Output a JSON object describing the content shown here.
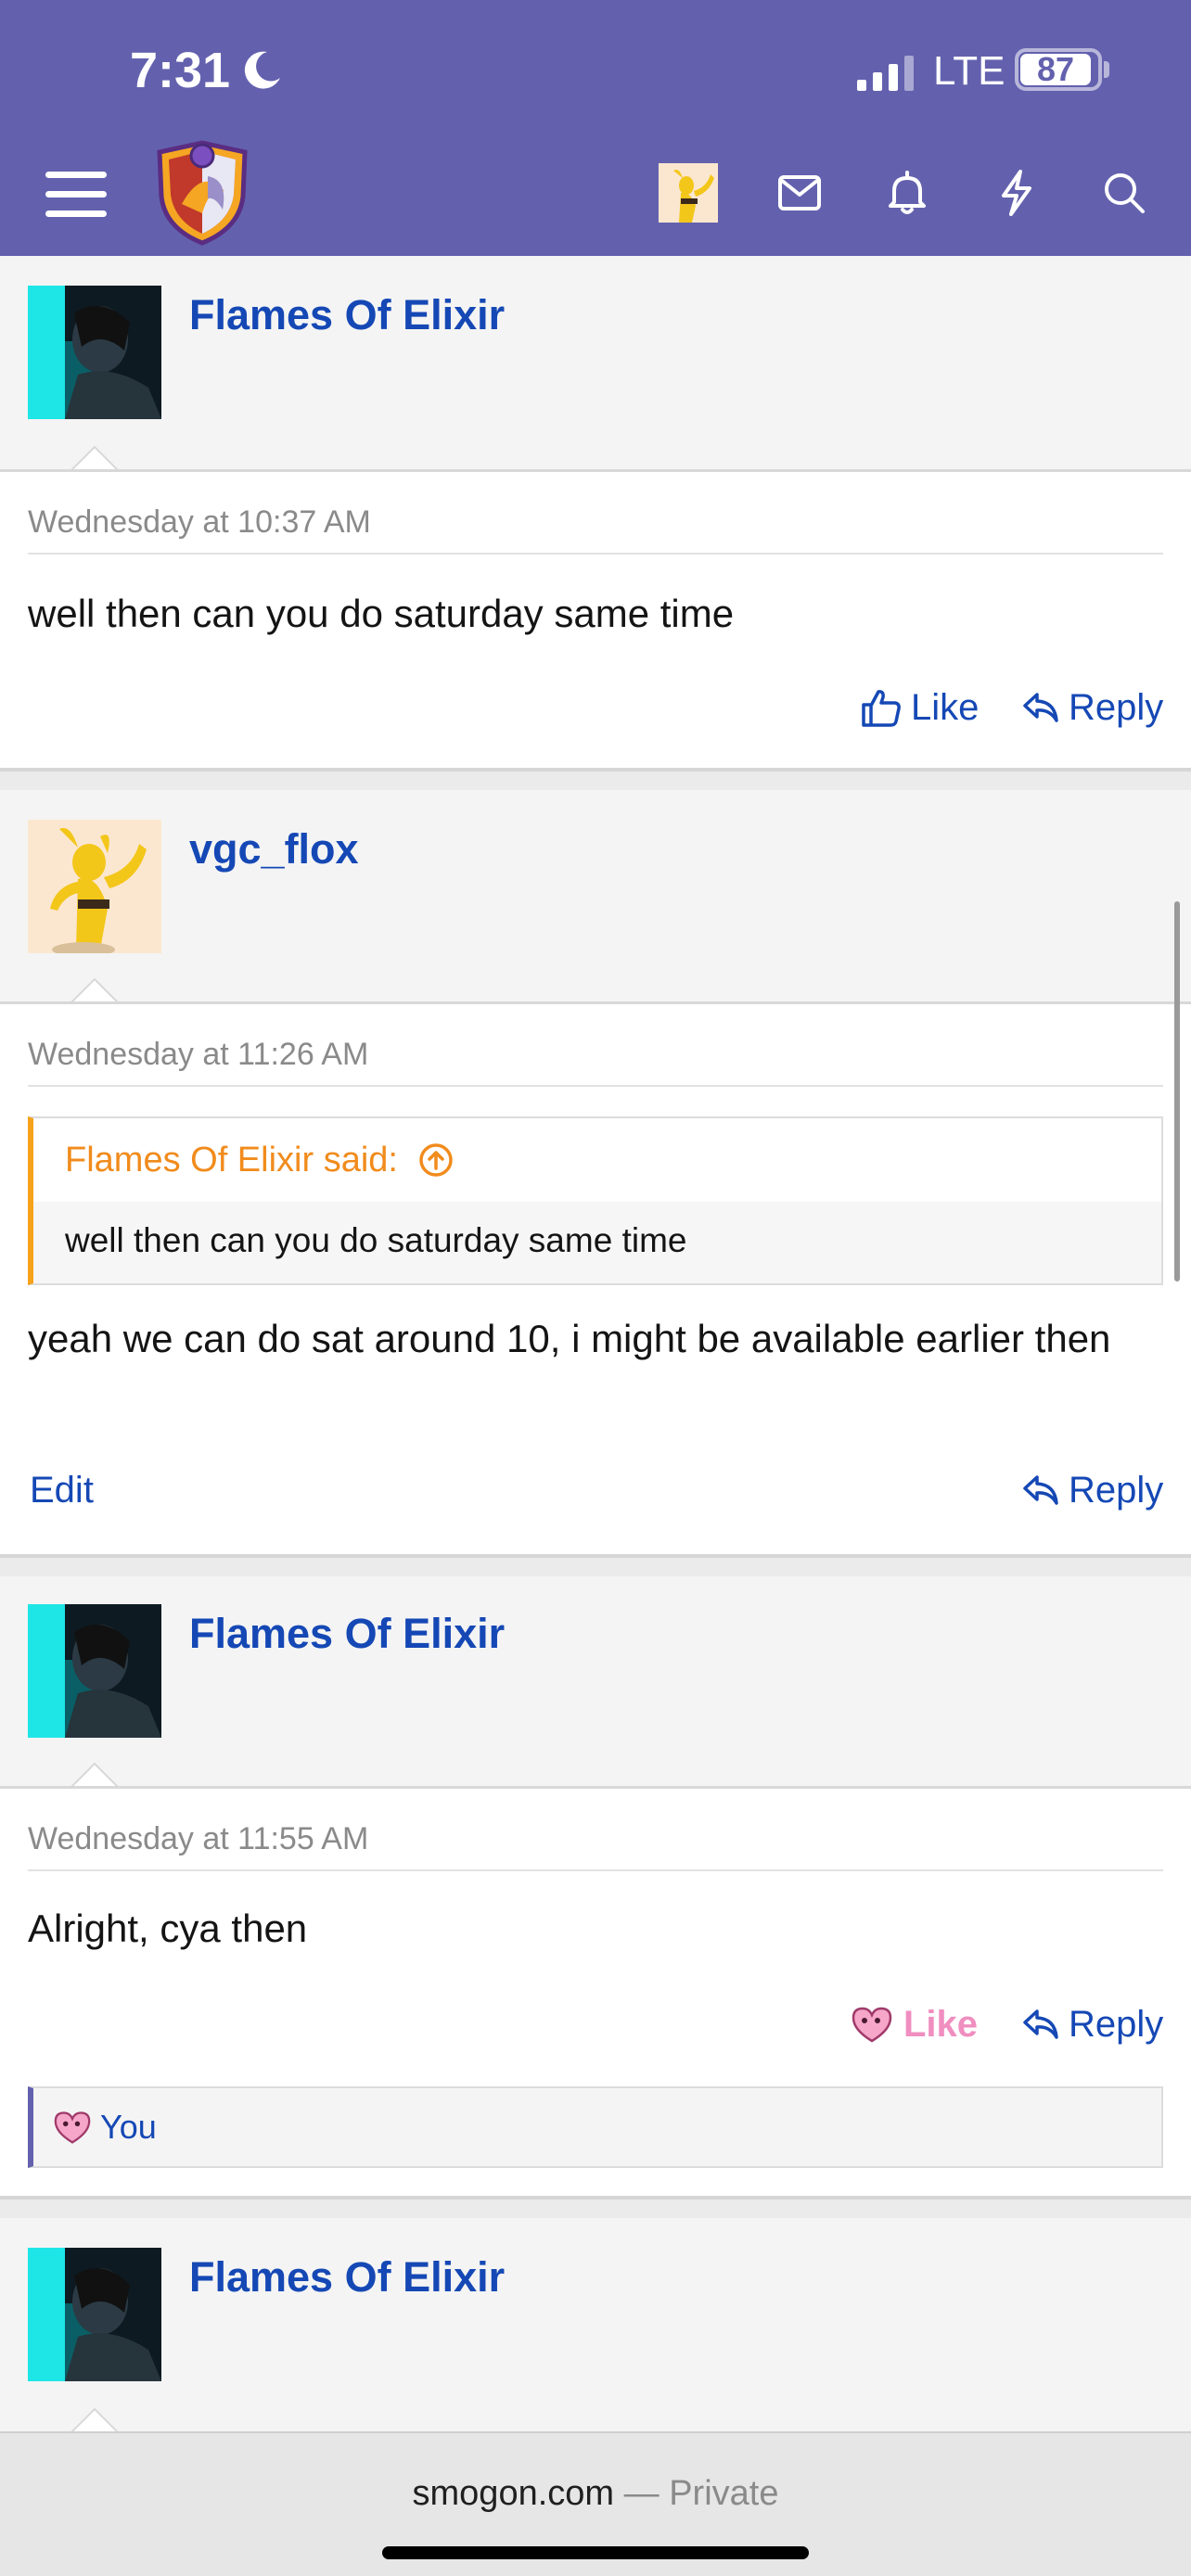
{
  "status_bar": {
    "time": "7:31",
    "network": "LTE",
    "battery": "87"
  },
  "header": {
    "menu_icon": "hamburger-icon",
    "logo_icon": "smogon-shield-logo",
    "icons": [
      "avatar",
      "envelope-icon",
      "bell-icon",
      "bolt-icon",
      "search-icon"
    ]
  },
  "posts": [
    {
      "author": "Flames Of Elixir",
      "timestamp": "Wednesday at 10:37 AM",
      "message": "well then can you do saturday same time",
      "like_label": "Like",
      "reply_label": "Reply"
    },
    {
      "author": "vgc_flox",
      "timestamp": "Wednesday at 11:26 AM",
      "quote_author": "Flames Of Elixir said:",
      "quote_text": "well then can you do saturday same time",
      "message": "yeah we can do sat around 10, i might be available earlier then",
      "edit_label": "Edit",
      "reply_label": "Reply"
    },
    {
      "author": "Flames Of Elixir",
      "timestamp": "Wednesday at 11:55 AM",
      "message": "Alright, cya then",
      "like_label": "Like",
      "reply_label": "Reply",
      "reaction_user": "You"
    },
    {
      "author": "Flames Of Elixir"
    }
  ],
  "browser": {
    "domain": "smogon.com",
    "separator": " — ",
    "privacy": "Private"
  },
  "colors": {
    "header": "#6361ae",
    "link": "#1548b5",
    "quote_accent": "#f7a21b",
    "liked": "#f08ec0"
  }
}
